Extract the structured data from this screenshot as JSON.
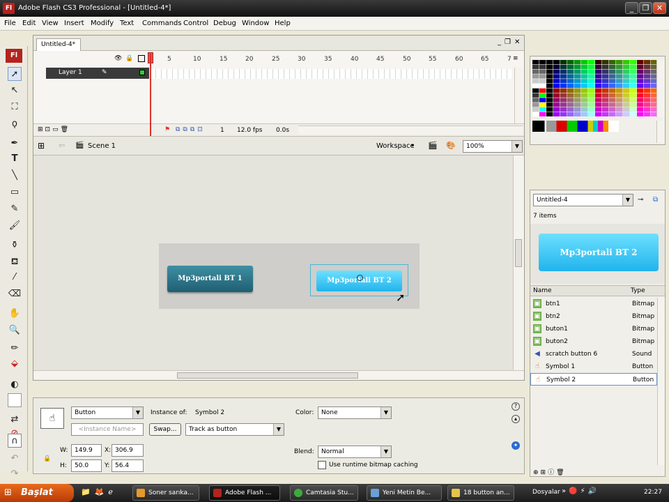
{
  "window": {
    "title": "Adobe Flash CS3 Professional - [Untitled-4*]",
    "app_icon": "Fl"
  },
  "menu": [
    "File",
    "Edit",
    "View",
    "Insert",
    "Modify",
    "Text",
    "Commands",
    "Control",
    "Debug",
    "Window",
    "Help"
  ],
  "document": {
    "tab": "Untitled-4*"
  },
  "timeline": {
    "frame_numbers": [
      "5",
      "10",
      "15",
      "20",
      "25",
      "30",
      "35",
      "40",
      "45",
      "50",
      "55",
      "60",
      "65",
      "7"
    ],
    "layer": "Layer 1",
    "current_frame": "1",
    "fps": "12.0 fps",
    "time": "0.0s"
  },
  "scenebar": {
    "scene": "Scene 1",
    "workspace": "Workspace",
    "zoom": "100%"
  },
  "stage": {
    "button1": "Mp3portali BT 1",
    "button2": "Mp3portali BT 2"
  },
  "properties": {
    "type": "Button",
    "instance_name_placeholder": "<Instance Name>",
    "instance_of_label": "Instance of:",
    "instance_of": "Symbol 2",
    "swap": "Swap...",
    "track": "Track as button",
    "color_label": "Color:",
    "color": "None",
    "blend_label": "Blend:",
    "blend": "Normal",
    "cache_label": "Use runtime bitmap caching",
    "w_label": "W:",
    "w": "149.9",
    "x_label": "X:",
    "x": "306.9",
    "h_label": "H:",
    "h": "50.0",
    "y_label": "Y:",
    "y": "56.4"
  },
  "library": {
    "doc": "Untitled-4",
    "count": "7 items",
    "preview": "Mp3portali BT 2",
    "col_name": "Name",
    "col_type": "Type",
    "items": [
      {
        "name": "btn1",
        "type": "Bitmap",
        "icon": "bitmap-icon"
      },
      {
        "name": "btn2",
        "type": "Bitmap",
        "icon": "bitmap-icon"
      },
      {
        "name": "buton1",
        "type": "Bitmap",
        "icon": "bitmap-icon"
      },
      {
        "name": "buton2",
        "type": "Bitmap",
        "icon": "bitmap-icon"
      },
      {
        "name": "scratch button 6",
        "type": "Sound",
        "icon": "sound-icon"
      },
      {
        "name": "Symbol 1",
        "type": "Button",
        "icon": "button-symbol-icon"
      },
      {
        "name": "Symbol 2",
        "type": "Button",
        "icon": "button-symbol-icon"
      }
    ]
  },
  "taskbar": {
    "start": "Başlat",
    "tasks": [
      "Soner sarıka...",
      "Adobe Flash ...",
      "Camtasia Stu...",
      "Yeni Metin Be...",
      "18 button an..."
    ],
    "dosyalar": "Dosyalar",
    "clock": "22:27"
  },
  "colors": {
    "accent_red": "#e0322a",
    "button1": "#2a6f83",
    "button2": "#2cc0f0",
    "taskbar": "#2a2a2a",
    "start": "#d4540f"
  }
}
